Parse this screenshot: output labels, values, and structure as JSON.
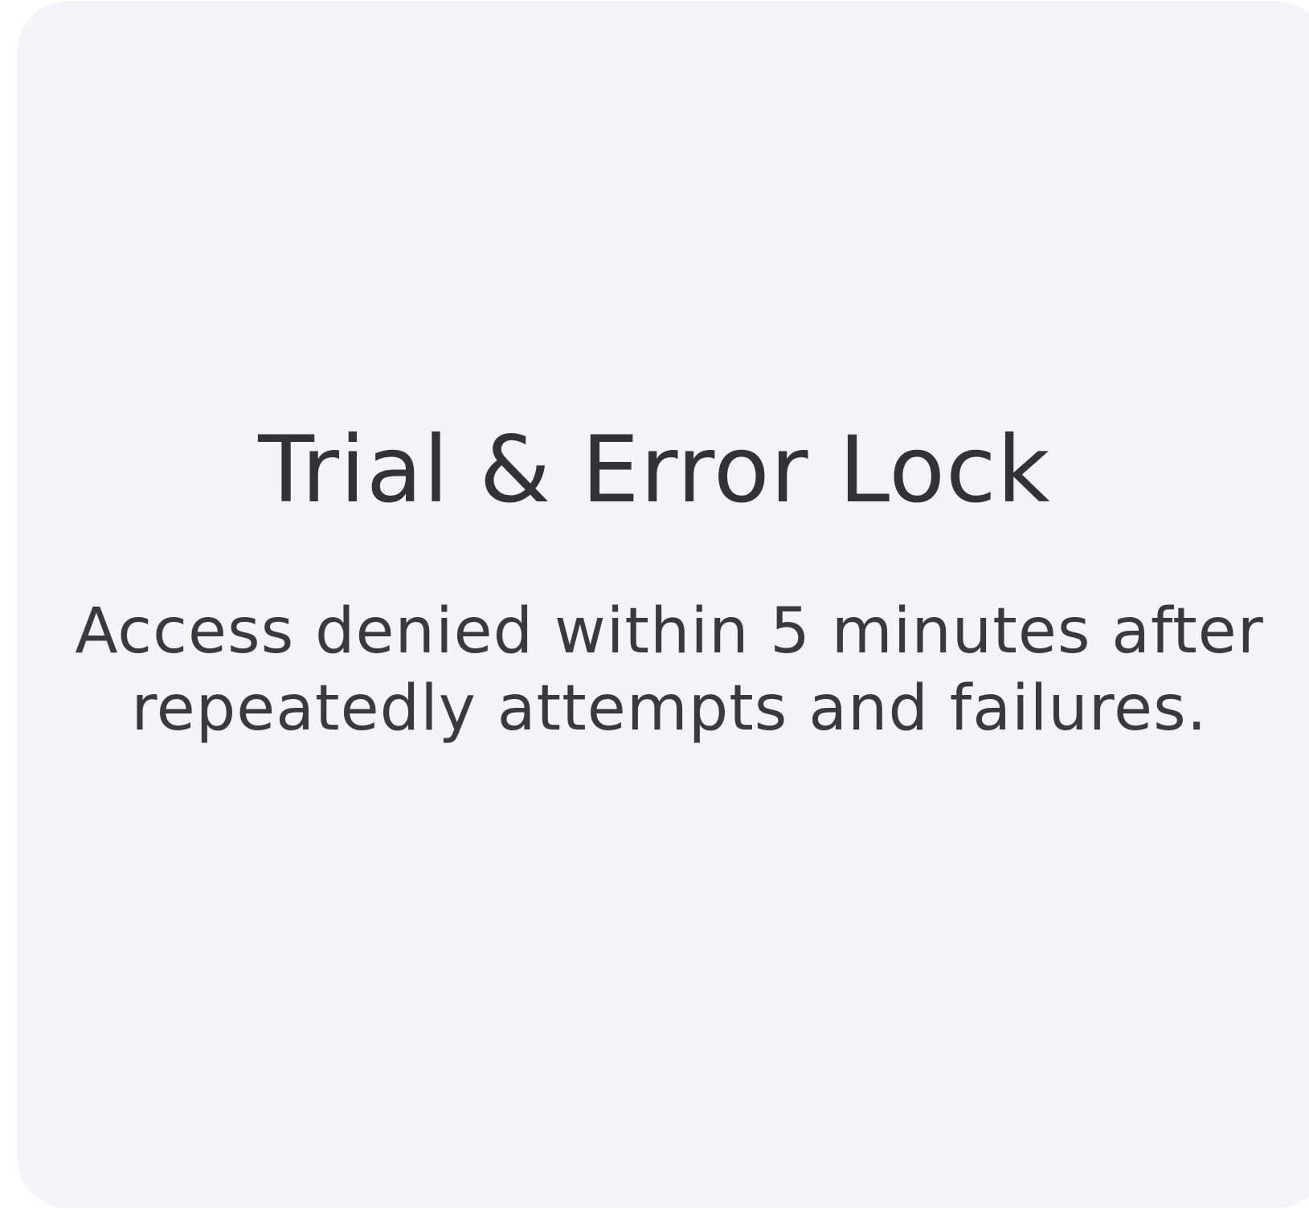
{
  "card": {
    "title": "Trial & Error Lock",
    "description": "Access denied within 5 minutes after repeatedly attempts and failures."
  },
  "colors": {
    "card_background": "#f4f4f8",
    "text_primary": "#333336"
  }
}
